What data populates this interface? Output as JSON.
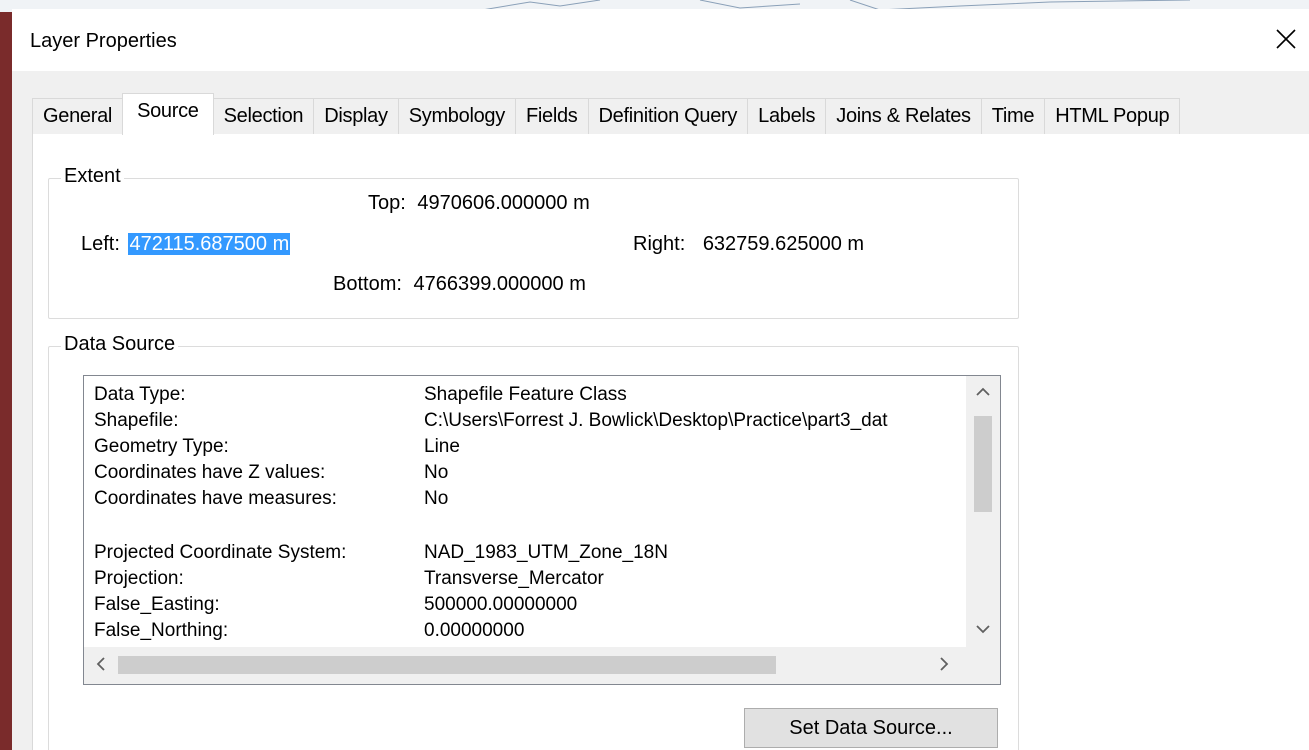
{
  "window": {
    "title": "Layer Properties",
    "close_glyph": "✕"
  },
  "tabs": [
    {
      "label": "General",
      "active": false
    },
    {
      "label": "Source",
      "active": true
    },
    {
      "label": "Selection",
      "active": false
    },
    {
      "label": "Display",
      "active": false
    },
    {
      "label": "Symbology",
      "active": false
    },
    {
      "label": "Fields",
      "active": false
    },
    {
      "label": "Definition Query",
      "active": false
    },
    {
      "label": "Labels",
      "active": false
    },
    {
      "label": "Joins & Relates",
      "active": false
    },
    {
      "label": "Time",
      "active": false
    },
    {
      "label": "HTML Popup",
      "active": false
    }
  ],
  "extent": {
    "group_label": "Extent",
    "top_label": "Top:",
    "top_value": "4970606.000000 m",
    "left_label": "Left:",
    "left_value": "472115.687500 m",
    "right_label": "Right:",
    "right_value": "632759.625000 m",
    "bottom_label": "Bottom:",
    "bottom_value": "4766399.000000 m"
  },
  "data_source": {
    "group_label": "Data Source",
    "rows": [
      {
        "key": "Data Type:",
        "value": "Shapefile Feature Class"
      },
      {
        "key": "Shapefile:",
        "value": "C:\\Users\\Forrest J. Bowlick\\Desktop\\Practice\\part3_dat"
      },
      {
        "key": "Geometry Type:",
        "value": "Line"
      },
      {
        "key": "Coordinates have Z values:",
        "value": "No"
      },
      {
        "key": "Coordinates have measures:",
        "value": "No"
      },
      {
        "key": "",
        "value": ""
      },
      {
        "key": "Projected Coordinate System:",
        "value": "NAD_1983_UTM_Zone_18N"
      },
      {
        "key": "Projection:",
        "value": "Transverse_Mercator"
      },
      {
        "key": "False_Easting:",
        "value": "500000.00000000"
      },
      {
        "key": "False_Northing:",
        "value": "0.00000000"
      }
    ],
    "button_label": "Set Data Source..."
  },
  "icons": {
    "scroll_up": "chevron-up-icon",
    "scroll_down": "chevron-down-icon",
    "scroll_left": "chevron-left-icon",
    "scroll_right": "chevron-right-icon",
    "close": "close-icon"
  }
}
